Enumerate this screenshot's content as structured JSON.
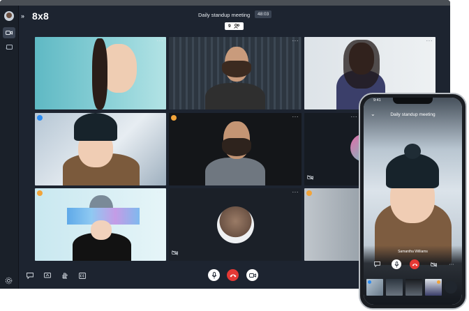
{
  "app": {
    "logo": "8x8",
    "meeting_title": "Daily standup meeting",
    "timer": "48:03",
    "participant_count": "9"
  },
  "colors": {
    "end_call": "#e53935",
    "badge_blue": "#2a8bf2",
    "badge_orange": "#f2a43a",
    "app_bg": "#1d2430"
  },
  "tiles": [
    {
      "menu": "···",
      "badge": ""
    },
    {
      "menu": "···",
      "badge": ""
    },
    {
      "menu": "···",
      "badge": ""
    },
    {
      "menu": "···",
      "badge": "blue"
    },
    {
      "menu": "···",
      "badge": "orange"
    },
    {
      "menu": "···",
      "badge": ""
    },
    {
      "menu": "···",
      "badge": "orange"
    },
    {
      "menu": "···",
      "badge": ""
    },
    {
      "menu": "",
      "badge": "orange"
    }
  ],
  "phone": {
    "status_time": "9:41",
    "title": "Daily standup meeting",
    "speaker_name": "Samantha Williams",
    "more": "···"
  }
}
